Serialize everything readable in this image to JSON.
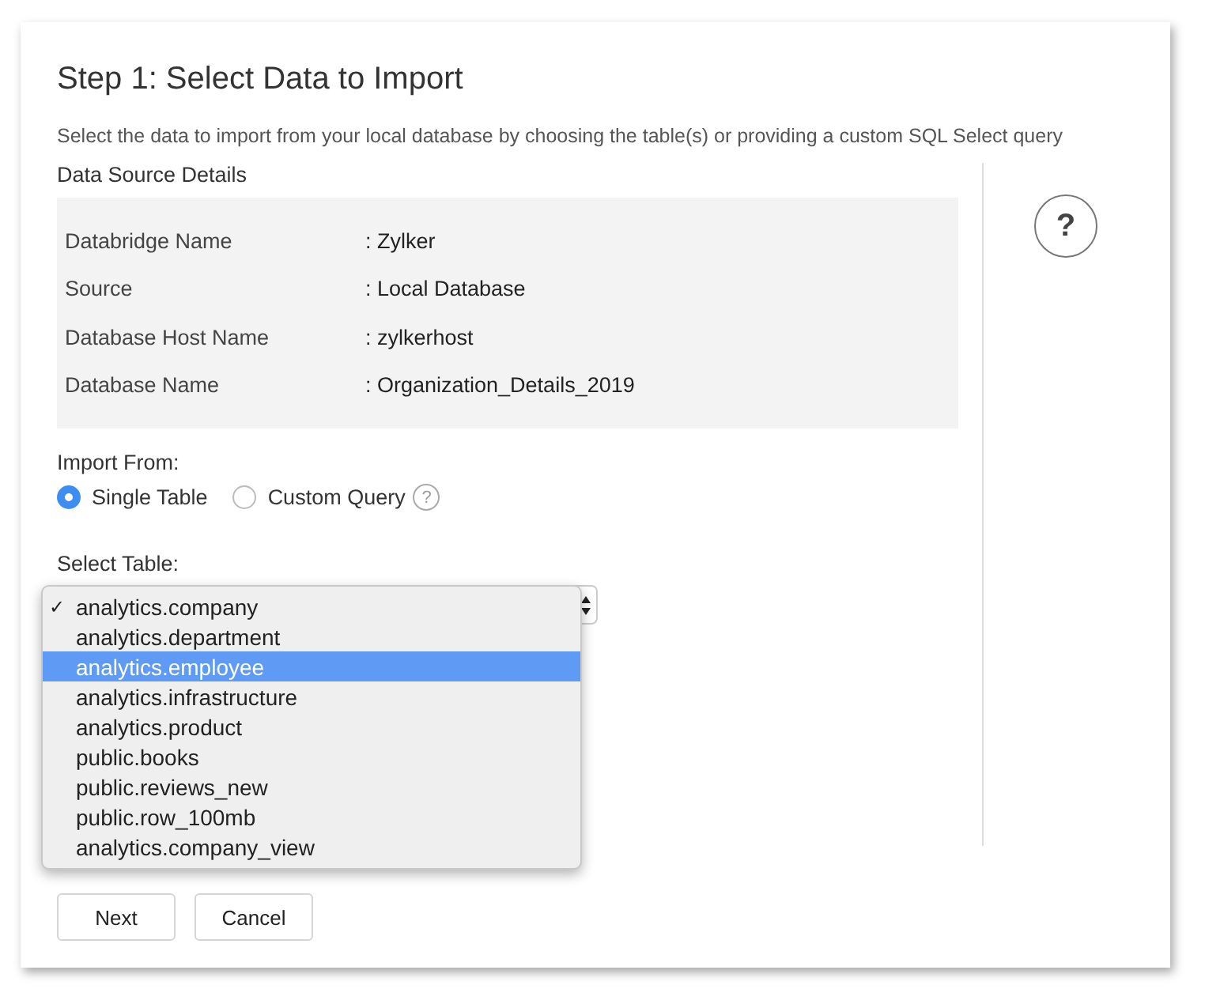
{
  "title": "Step 1: Select Data to Import",
  "subtitle": "Select the data to import from your local database by choosing the table(s) or providing a custom SQL Select query",
  "source_heading": "Data Source Details",
  "details": [
    {
      "label": "Databridge Name",
      "value": ": Zylker"
    },
    {
      "label": "Source",
      "value": ": Local Database"
    },
    {
      "label": "Database Host Name",
      "value": ": zylkerhost"
    },
    {
      "label": "Database Name",
      "value": ": Organization_Details_2019"
    }
  ],
  "import_from": {
    "label": "Import From:",
    "options": [
      {
        "label": "Single Table",
        "selected": true,
        "help": false
      },
      {
        "label": "Custom Query",
        "selected": false,
        "help": true
      }
    ],
    "help_mark": "?"
  },
  "select_table": {
    "label": "Select Table:",
    "options": [
      {
        "label": "analytics.company",
        "selected": true,
        "highlighted": false
      },
      {
        "label": "analytics.department",
        "selected": false,
        "highlighted": false
      },
      {
        "label": "analytics.employee",
        "selected": false,
        "highlighted": true
      },
      {
        "label": "analytics.infrastructure",
        "selected": false,
        "highlighted": false
      },
      {
        "label": "analytics.product",
        "selected": false,
        "highlighted": false
      },
      {
        "label": "public.books",
        "selected": false,
        "highlighted": false
      },
      {
        "label": "public.reviews_new",
        "selected": false,
        "highlighted": false
      },
      {
        "label": "public.row_100mb",
        "selected": false,
        "highlighted": false
      },
      {
        "label": "analytics.company_view",
        "selected": false,
        "highlighted": false
      }
    ],
    "check_mark": "✓"
  },
  "buttons": [
    "Next",
    "Cancel"
  ],
  "help_button": "?"
}
